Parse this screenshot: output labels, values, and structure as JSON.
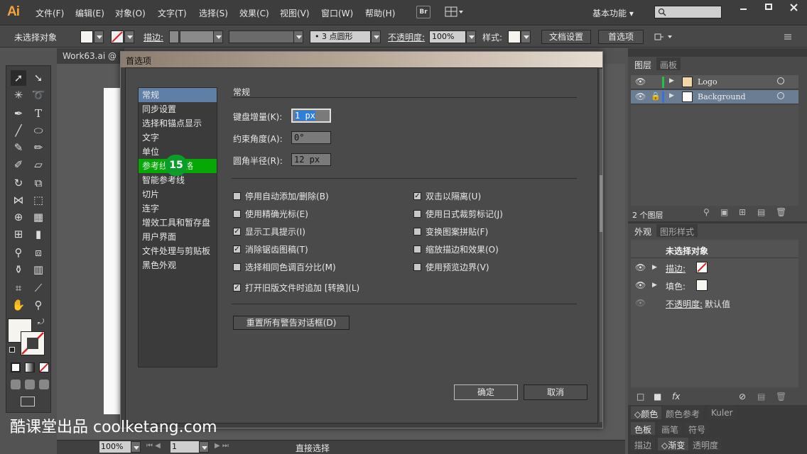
{
  "app": {
    "logo": "Ai"
  },
  "menubar": {
    "items": [
      "文件(F)",
      "编辑(E)",
      "对象(O)",
      "文字(T)",
      "选择(S)",
      "效果(C)",
      "视图(V)",
      "窗口(W)",
      "帮助(H)"
    ],
    "bridge_label": "Br",
    "workspace": "基本功能"
  },
  "controlbar": {
    "selection": "未选择对象",
    "stroke_label": "描边:",
    "brush_label": "3 点圆形",
    "opacity_label": "不透明度:",
    "opacity_value": "100%",
    "style_label": "样式:",
    "doc_settings": "文档设置",
    "preferences": "首选项"
  },
  "document": {
    "tab": "Work63.ai @"
  },
  "dialog": {
    "title": "首选项",
    "categories": [
      "常规",
      "同步设置",
      "选择和锚点显示",
      "文字",
      "单位",
      "参考线和网格",
      "智能参考线",
      "切片",
      "连字",
      "增效工具和暂存盘",
      "用户界面",
      "文件处理与剪贴板",
      "黑色外观"
    ],
    "badge": "15",
    "section_title": "常规",
    "fields": [
      {
        "label": "键盘增量(K):",
        "value": "1 px"
      },
      {
        "label": "约束角度(A):",
        "value": "0°"
      },
      {
        "label": "圆角半径(R):",
        "value": "12 px"
      }
    ],
    "left_checks": [
      {
        "label": "停用自动添加/删除(B)",
        "checked": false
      },
      {
        "label": "使用精确光标(E)",
        "checked": false
      },
      {
        "label": "显示工具提示(I)",
        "checked": true
      },
      {
        "label": "消除锯齿图稿(T)",
        "checked": true
      },
      {
        "label": "选择相同色调百分比(M)",
        "checked": false
      },
      {
        "label": "打开旧版文件时追加 [转换](L)",
        "checked": true
      }
    ],
    "right_checks": [
      {
        "label": "双击以隔离(U)",
        "checked": true
      },
      {
        "label": "使用日式裁剪标记(J)",
        "checked": false
      },
      {
        "label": "变换图案拼贴(F)",
        "checked": false
      },
      {
        "label": "缩放描边和效果(O)",
        "checked": false
      },
      {
        "label": "使用预览边界(V)",
        "checked": false
      }
    ],
    "reset_button": "重置所有警告对话框(D)",
    "ok_button": "确定",
    "cancel_button": "取消"
  },
  "layers_panel": {
    "tabs": [
      "图层",
      "画板"
    ],
    "layers": [
      {
        "name": "Logo",
        "color": "#23c14a"
      },
      {
        "name": "Background",
        "color": "#3b6fe0"
      }
    ],
    "count": "2 个图层"
  },
  "appearance_panel": {
    "tabs": [
      "外观",
      "图形样式"
    ],
    "header": "未选择对象",
    "stroke_label": "描边:",
    "fill_label": "填色:",
    "opacity_label": "不透明度:",
    "opacity_value": "默认值"
  },
  "color_panels": {
    "row1": [
      "颜色",
      "颜色参考",
      "Kuler"
    ],
    "row2": [
      "色板",
      "画笔",
      "符号"
    ],
    "row3": [
      "描边",
      "渐变",
      "透明度"
    ]
  },
  "statusbar": {
    "zoom": "100%",
    "page": "1",
    "tool": "直接选择"
  },
  "watermark": "酷课堂出品 coolketang.com"
}
